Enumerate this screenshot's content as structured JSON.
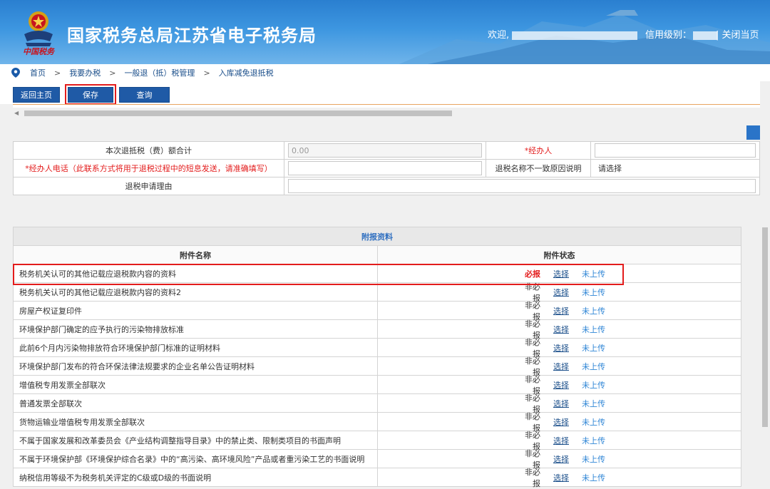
{
  "header": {
    "site_title": "国家税务总局江苏省电子税务局",
    "emblem_script": "中国税务",
    "welcome_label": "欢迎,",
    "credit_label": "信用级别：",
    "close_label": "| 关闭当页"
  },
  "breadcrumb": {
    "items": [
      "首页",
      "我要办税",
      "一般退（抵）税管理",
      "入库减免退抵税"
    ],
    "separator": ">"
  },
  "toolbar": {
    "back_label": "返回主页",
    "save_label": "保存",
    "query_label": "查询"
  },
  "form": {
    "total_label": "本次退抵税（费）额合计",
    "total_value": "0.00",
    "handler_label": "*经办人",
    "phone_label": "*经办人电话（此联系方式将用于退税过程中的短息发送，请准确填写）",
    "mismatch_label": "退税名称不一致原因说明",
    "mismatch_value": "请选择",
    "reason_label": "退税申请理由"
  },
  "attachments": {
    "section_title": "附报资料",
    "col_name": "附件名称",
    "col_status": "附件状态",
    "choose_label": "选择",
    "rows": [
      {
        "name": "税务机关认可的其他记载应退税款内容的资料",
        "required": "必报",
        "upload": "未上传",
        "must": true
      },
      {
        "name": "税务机关认可的其他记载应退税款内容的资料2",
        "required": "非必报",
        "upload": "未上传",
        "must": false
      },
      {
        "name": "房屋产权证复印件",
        "required": "非必报",
        "upload": "未上传",
        "must": false
      },
      {
        "name": "环境保护部门确定的应予执行的污染物排放标准",
        "required": "非必报",
        "upload": "未上传",
        "must": false
      },
      {
        "name": "此前6个月内污染物排放符合环境保护部门标准的证明材料",
        "required": "非必报",
        "upload": "未上传",
        "must": false
      },
      {
        "name": "环境保护部门发布的符合环保法律法规要求的企业名单公告证明材料",
        "required": "非必报",
        "upload": "未上传",
        "must": false
      },
      {
        "name": "增值税专用发票全部联次",
        "required": "非必报",
        "upload": "未上传",
        "must": false
      },
      {
        "name": "普通发票全部联次",
        "required": "非必报",
        "upload": "未上传",
        "must": false
      },
      {
        "name": "货物运输业增值税专用发票全部联次",
        "required": "非必报",
        "upload": "未上传",
        "must": false
      },
      {
        "name": "不属于国家发展和改革委员会《产业结构调整指导目录》中的禁止类、限制类项目的书面声明",
        "required": "非必报",
        "upload": "未上传",
        "must": false
      },
      {
        "name": "不属于环境保护部《环境保护综合名录》中的“高污染、高环境风险”产品或者重污染工艺的书面说明",
        "required": "非必报",
        "upload": "未上传",
        "must": false
      },
      {
        "name": "纳税信用等级不为税务机关评定的C级或D级的书面说明",
        "required": "非必报",
        "upload": "未上传",
        "must": false
      }
    ]
  },
  "colors": {
    "brand_blue": "#1f5aa6",
    "highlight_red": "#e31c1c",
    "link_blue": "#2f86d6"
  }
}
